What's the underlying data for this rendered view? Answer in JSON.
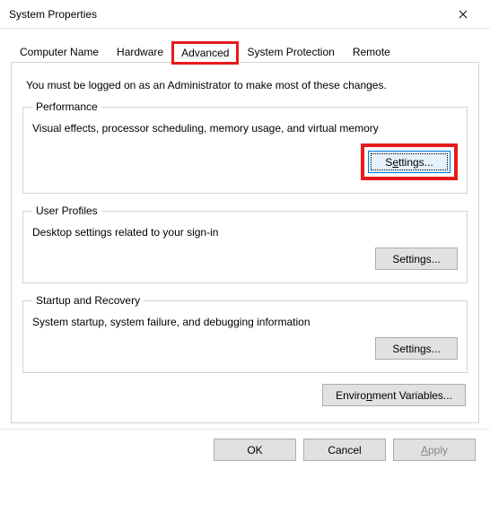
{
  "window": {
    "title": "System Properties"
  },
  "tabs": {
    "computer_name": "Computer Name",
    "hardware": "Hardware",
    "advanced": "Advanced",
    "system_protection": "System Protection",
    "remote": "Remote"
  },
  "intro": "You must be logged on as an Administrator to make most of these changes.",
  "performance": {
    "legend": "Performance",
    "desc": "Visual effects, processor scheduling, memory usage, and virtual memory",
    "button_prefix": "S",
    "button_u": "e",
    "button_suffix": "ttings..."
  },
  "user_profiles": {
    "legend": "User Profiles",
    "desc": "Desktop settings related to your sign-in",
    "button": "Settings..."
  },
  "startup": {
    "legend": "Startup and Recovery",
    "desc": "System startup, system failure, and debugging information",
    "button": "Settings..."
  },
  "env": {
    "button_prefix": "Enviro",
    "button_u": "n",
    "button_suffix": "ment Variables..."
  },
  "footer": {
    "ok": "OK",
    "cancel": "Cancel",
    "apply_u": "A",
    "apply_suffix": "pply"
  }
}
